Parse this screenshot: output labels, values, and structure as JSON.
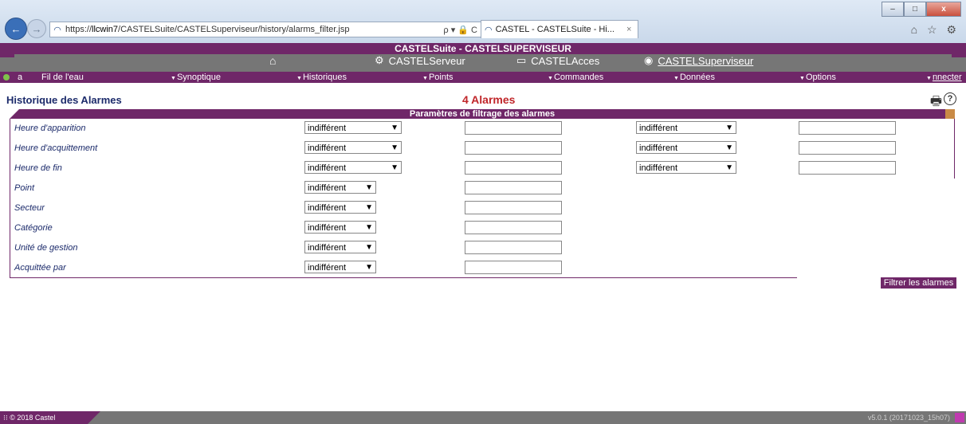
{
  "browser": {
    "url_prefix": "https://",
    "url_host": "llcwin7",
    "url_path": "/CASTELSuite/CASTELSuperviseur/history/alarms_filter.jsp",
    "address_tools": "ρ ▾ 🔒 C",
    "tab_title": "CASTEL - CASTELSuite - Hi...",
    "tab_close": "×",
    "back_icon": "←",
    "forward_icon": "→",
    "window_minimize": "–",
    "window_maximize": "□",
    "window_close": "x",
    "tools_icons": "⌂ ☆ ⚙"
  },
  "app": {
    "title": "CASTELSuite - CASTELSUPERVISEUR",
    "modules": [
      {
        "label": "CASTELServeur",
        "icon": "gears-icon"
      },
      {
        "label": "CASTELAcces",
        "icon": "card-reader-icon"
      },
      {
        "label": "CASTELSuperviseur",
        "icon": "eye-icon"
      }
    ],
    "home_icon": "⌂"
  },
  "menu": {
    "user_initial": "a",
    "items": [
      "Fil de l'eau",
      "Synoptique",
      "Historiques",
      "Points",
      "Commandes",
      "Données",
      "Options"
    ],
    "logout": "nnecter"
  },
  "page": {
    "title": "Historique des Alarmes",
    "count_title": "4 Alarmes",
    "section_title": "Paramètres de filtrage des alarmes",
    "filter_button": "Filtrer les alarmes"
  },
  "filters": [
    {
      "label": "Heure d'apparition",
      "select1": "indifférent",
      "input1": "",
      "select2": "indifférent",
      "input2": ""
    },
    {
      "label": "Heure d'acquittement",
      "select1": "indifférent",
      "input1": "",
      "select2": "indifférent",
      "input2": ""
    },
    {
      "label": "Heure de fin",
      "select1": "indifférent",
      "input1": "",
      "select2": "indifférent",
      "input2": ""
    },
    {
      "label": "Point",
      "select1": "indifférent",
      "input1": ""
    },
    {
      "label": "Secteur",
      "select1": "indifférent",
      "input1": ""
    },
    {
      "label": "Catégorie",
      "select1": "indifférent",
      "input1": ""
    },
    {
      "label": "Unité de gestion",
      "select1": "indifférent",
      "input1": ""
    },
    {
      "label": "Acquittée par",
      "select1": "indifférent",
      "input1": ""
    }
  ],
  "footer": {
    "copyright": "© 2018 Castel",
    "version": "v5.0.1 (20171023_15h07)"
  },
  "colors": {
    "brand": "#6f2768",
    "header_gray": "#767676",
    "title_blue": "#1c2b6b",
    "alert_red": "#c0262a"
  }
}
